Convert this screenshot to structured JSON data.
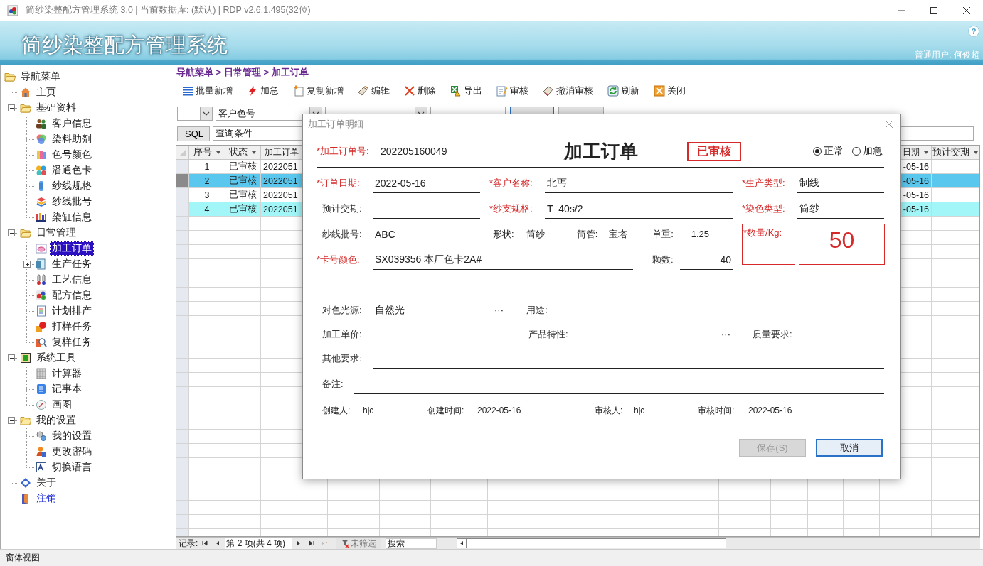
{
  "window": {
    "title": "简纱染整配方管理系统 3.0 | 当前数据库: (默认) | RDP v2.6.1.495(32位)"
  },
  "banner": {
    "title": "简纱染整配方管理系统",
    "help": "?",
    "user": "普通用户: 何俊超"
  },
  "nav": {
    "items": [
      {
        "label": "导航菜单",
        "kind": "folder",
        "selected": false,
        "children": [
          {
            "label": "主页",
            "kind": "home",
            "selected": false
          },
          {
            "label": "基础资料",
            "kind": "folder",
            "selected": false,
            "expanded": true,
            "children": [
              {
                "label": "客户信息",
                "kind": "customers",
                "selected": false
              },
              {
                "label": "染料助剂",
                "kind": "dyes",
                "selected": false
              },
              {
                "label": "色号颜色",
                "kind": "swatch",
                "selected": false
              },
              {
                "label": "潘通色卡",
                "kind": "pantone",
                "selected": false
              },
              {
                "label": "纱线规格",
                "kind": "yarn-spec",
                "selected": false
              },
              {
                "label": "纱线批号",
                "kind": "yarn-batch",
                "selected": false
              },
              {
                "label": "染缸信息",
                "kind": "vat",
                "selected": false
              }
            ]
          },
          {
            "label": "日常管理",
            "kind": "folder",
            "selected": false,
            "expanded": true,
            "children": [
              {
                "label": "加工订单",
                "kind": "order",
                "selected": true
              },
              {
                "label": "生产任务",
                "kind": "task",
                "selected": false,
                "expanded": false
              },
              {
                "label": "工艺信息",
                "kind": "process",
                "selected": false
              },
              {
                "label": "配方信息",
                "kind": "formula",
                "selected": false
              },
              {
                "label": "计划排产",
                "kind": "plan",
                "selected": false
              },
              {
                "label": "打样任务",
                "kind": "sample",
                "selected": false
              },
              {
                "label": "复样任务",
                "kind": "resample",
                "selected": false
              }
            ]
          },
          {
            "label": "系统工具",
            "kind": "tools",
            "selected": false,
            "expanded": true,
            "children": [
              {
                "label": "计算器",
                "kind": "calculator",
                "selected": false
              },
              {
                "label": "记事本",
                "kind": "notepad",
                "selected": false
              },
              {
                "label": "画图",
                "kind": "paint",
                "selected": false
              }
            ]
          },
          {
            "label": "我的设置",
            "kind": "folder",
            "selected": false,
            "expanded": true,
            "children": [
              {
                "label": "我的设置",
                "kind": "settings",
                "selected": false
              },
              {
                "label": "更改密码",
                "kind": "password",
                "selected": false
              },
              {
                "label": "切换语言",
                "kind": "language",
                "selected": false
              }
            ]
          },
          {
            "label": "关于",
            "kind": "about",
            "selected": false
          },
          {
            "label": "注销",
            "kind": "logout",
            "selected": false
          }
        ]
      }
    ]
  },
  "breadcrumb": "导航菜单 > 日常管理 > 加工订单",
  "toolbar": [
    {
      "label": "批量新增",
      "kind": "batch"
    },
    {
      "label": "加急",
      "kind": "urgent"
    },
    {
      "label": "复制新增",
      "kind": "copy"
    },
    {
      "label": "编辑",
      "kind": "edit"
    },
    {
      "label": "删除",
      "kind": "delete"
    },
    {
      "label": "导出",
      "kind": "export"
    },
    {
      "label": "审核",
      "kind": "audit"
    },
    {
      "label": "撤消审核",
      "kind": "unaudit"
    },
    {
      "label": "刷新",
      "kind": "refresh"
    },
    {
      "label": "关闭",
      "kind": "close"
    }
  ],
  "filter": {
    "field": "客户色号"
  },
  "sql": {
    "button": "SQL",
    "field": "查询条件"
  },
  "grid": {
    "columns": [
      {
        "label": "序号"
      },
      {
        "label": "状态"
      },
      {
        "label": "加工订单"
      },
      {
        "label": "日期"
      },
      {
        "label": "预计交期"
      }
    ],
    "rows": [
      {
        "selected": false,
        "highlighted": false,
        "cells": [
          "1",
          "已审核",
          "2022051",
          "-05-16"
        ]
      },
      {
        "selected": true,
        "highlighted": false,
        "cells": [
          "2",
          "已审核",
          "2022051",
          "-05-16"
        ]
      },
      {
        "selected": false,
        "highlighted": false,
        "cells": [
          "3",
          "已审核",
          "2022051",
          "-05-16"
        ]
      },
      {
        "selected": false,
        "highlighted": true,
        "cells": [
          "4",
          "已审核",
          "2022051",
          "-05-16"
        ]
      }
    ]
  },
  "record_nav": {
    "label": "记录:",
    "position": "第 2 项(共 4 项)",
    "filter": "未筛选",
    "search": {
      "placeholder": "搜索"
    }
  },
  "dialog": {
    "title": "加工订单明细",
    "heading": "加工订单",
    "status": "已审核",
    "order_no": {
      "label": "*加工订单号:",
      "required": true,
      "value": "202205160049"
    },
    "priority": [
      {
        "label": "正常",
        "selected": true
      },
      {
        "label": "加急",
        "selected": false
      }
    ],
    "rows": [
      [
        {
          "kind": "text",
          "label": "*订单日期:",
          "required": true,
          "value": "2022-05-16"
        },
        {
          "kind": "text",
          "label": "*客户名称:",
          "required": true,
          "value": "北丐"
        },
        {
          "kind": "text",
          "label": "*生产类型:",
          "required": true,
          "value": "制线"
        }
      ],
      [
        {
          "kind": "text",
          "label": "预计交期:",
          "required": false
        },
        {
          "kind": "text",
          "label": "*纱支规格:",
          "required": true,
          "value": "T_40s/2"
        },
        {
          "kind": "text",
          "label": "*染色类型:",
          "required": true,
          "value": "筒纱"
        }
      ],
      [
        {
          "kind": "text",
          "label": "纱线批号:",
          "required": false,
          "value": "ABC",
          "parts": [
            {
              "label": "形状:",
              "value": "筒纱"
            },
            {
              "label": "筒管:",
              "value": "宝塔"
            },
            {
              "label": "单重:",
              "value": "1.25"
            }
          ]
        }
      ],
      [
        {
          "kind": "text",
          "label": "*卡号颜色:",
          "required": true,
          "value": "SX039356  本厂色卡2A#"
        },
        {
          "kind": "number",
          "label": "颗数:",
          "required": false,
          "value": "40"
        }
      ],
      [
        {
          "kind": "text",
          "label": "对色光源:",
          "required": false,
          "value": "自然光",
          "button": "···"
        },
        {
          "kind": "text",
          "label": "用途:",
          "required": false
        }
      ],
      [
        {
          "kind": "text",
          "label": "加工单价:",
          "required": false
        },
        {
          "kind": "text",
          "label": "产品特性:",
          "required": false,
          "button": "···"
        },
        {
          "kind": "text",
          "label": "质量要求:",
          "required": false
        }
      ],
      [
        {
          "kind": "text",
          "label": "其他要求:",
          "required": false
        }
      ],
      [
        {
          "kind": "text",
          "label": "备注:",
          "required": false
        }
      ]
    ],
    "quantity": {
      "label": "*数量/Kg:",
      "required": true,
      "value": "50"
    },
    "meta": [
      {
        "label": "创建人:",
        "value": "hjc"
      },
      {
        "label": "创建时间:",
        "value": "2022-05-16"
      },
      {
        "label": "审核人:",
        "value": "hjc"
      },
      {
        "label": "审核时间:",
        "value": "2022-05-16"
      }
    ],
    "buttons": [
      {
        "label": "保存(S)",
        "disabled": true
      },
      {
        "label": "取消",
        "disabled": false
      }
    ]
  },
  "status_bar": "窗体视图"
}
